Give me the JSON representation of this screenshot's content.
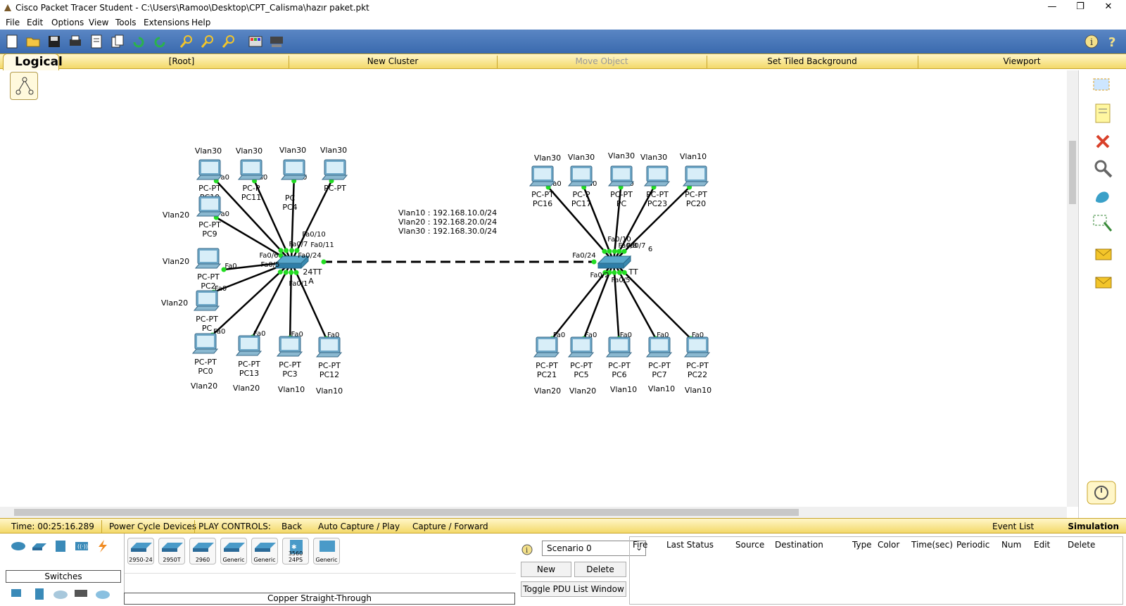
{
  "window": {
    "title": "Cisco Packet Tracer Student - C:\\Users\\Ramoo\\Desktop\\CPT_Calisma\\hazır paket.pkt",
    "controls": [
      "—",
      "❐",
      "✕"
    ]
  },
  "menu": [
    "File",
    "Edit",
    "Options",
    "View",
    "Tools",
    "Extensions",
    "Help"
  ],
  "navbar": {
    "tab": "Logical",
    "root": "[Root]",
    "new_cluster": "New Cluster",
    "move_object": "Move Object",
    "tiled_bg": "Set Tiled Background",
    "viewport": "Viewport"
  },
  "note": [
    "Vlan10 : 192.168.10.0/24",
    "Vlan20 : 192.168.20.0/24",
    "Vlan30 : 192.168.30.0/24"
  ],
  "switch_a": {
    "model_fragment": "24TT",
    "name_fragment": "A",
    "ports": [
      "Fa0/10",
      "Fa0/11",
      "Fa0/6",
      "Fa0/5",
      "Fa0/24",
      "Fa0/1",
      "Fa0/7"
    ]
  },
  "switch_b": {
    "model_fragment": "TT",
    "ports": [
      "Fa0/10",
      "Fa0/24",
      "Fa0/5",
      "Fa0/2",
      "Fa0/8",
      "Fa0/7",
      "6"
    ]
  },
  "pcs_left": [
    {
      "name": "PC10",
      "type": "PC-PT",
      "vlan": "Vlan30",
      "port": "Fa0"
    },
    {
      "name": "PC11",
      "type": "PC-P",
      "vlan": "Vlan30",
      "port": "Fa0"
    },
    {
      "name": "PC4",
      "type": "PC",
      "vlan": "Vlan30",
      "port": "Fa0"
    },
    {
      "name": "",
      "type": "PC-PT",
      "vlan": "Vlan30",
      "port": "Fa0"
    },
    {
      "name": "PC9",
      "type": "PC-PT",
      "vlan": "Vlan20",
      "port": "Fa0"
    },
    {
      "name": "PC2",
      "type": "PC-PT",
      "vlan": "Vlan20",
      "port": "Fa0"
    },
    {
      "name": "PC",
      "type": "PC-PT",
      "vlan": "Vlan20",
      "port": "Fa0"
    },
    {
      "name": "PC0",
      "type": "PC-PT",
      "vlan": "Vlan20",
      "port": "Fa0"
    },
    {
      "name": "PC13",
      "type": "PC-PT",
      "vlan": "Vlan20",
      "port": "Fa0"
    },
    {
      "name": "PC3",
      "type": "PC-PT",
      "vlan": "Vlan10",
      "port": "Fa0"
    },
    {
      "name": "PC12",
      "type": "PC-PT",
      "vlan": "Vlan10",
      "port": "Fa0"
    }
  ],
  "pcs_right": [
    {
      "name": "PC16",
      "type": "PC-PT",
      "vlan": "Vlan30",
      "port": "Fa0"
    },
    {
      "name": "PC17",
      "type": "PC-P",
      "vlan": "Vlan30",
      "port": "Fa0"
    },
    {
      "name": "PC",
      "type": "PC-PT",
      "vlan": "Vlan30",
      "port": "Fa0"
    },
    {
      "name": "PC23",
      "type": "PC-PT",
      "vlan": "Vlan30",
      "port": "Fa0"
    },
    {
      "name": "PC20",
      "type": "PC-PT",
      "vlan": "Vlan10",
      "port": "Fa0"
    },
    {
      "name": "PC21",
      "type": "PC-PT",
      "vlan": "Vlan20",
      "port": "Fa0"
    },
    {
      "name": "PC5",
      "type": "PC-PT",
      "vlan": "Vlan20",
      "port": "Fa0"
    },
    {
      "name": "PC6",
      "type": "PC-PT",
      "vlan": "Vlan10",
      "port": "Fa0"
    },
    {
      "name": "PC7",
      "type": "PC-PT",
      "vlan": "Vlan10",
      "port": "Fa0"
    },
    {
      "name": "PC22",
      "type": "PC-PT",
      "vlan": "Vlan10",
      "port": "Fa0"
    }
  ],
  "status": {
    "time": "Time: 00:25:16.289",
    "power_cycle": "Power Cycle Devices",
    "play_controls": "PLAY CONTROLS:",
    "back": "Back",
    "auto_capture": "Auto Capture / Play",
    "capture_forward": "Capture / Forward",
    "event_list": "Event List",
    "mode": "Simulation"
  },
  "device_panel": {
    "category": "Switches",
    "devices": [
      "2950-24",
      "2950T",
      "2960",
      "Generic",
      "Generic",
      "3560 24PS",
      "Generic"
    ],
    "cable": "Copper Straight-Through"
  },
  "scenario": {
    "selected": "Scenario 0",
    "new": "New",
    "delete": "Delete",
    "toggle": "Toggle PDU List Window"
  },
  "pdu_columns": [
    "Fire",
    "Last Status",
    "Source",
    "Destination",
    "Type",
    "Color",
    "Time(sec)",
    "Periodic",
    "Num",
    "Edit",
    "Delete"
  ],
  "colors": {
    "toolbar": "#4a78b8",
    "yellow_bar": "#f3d96a",
    "link": "#000000",
    "port_ok": "#22dd22"
  }
}
